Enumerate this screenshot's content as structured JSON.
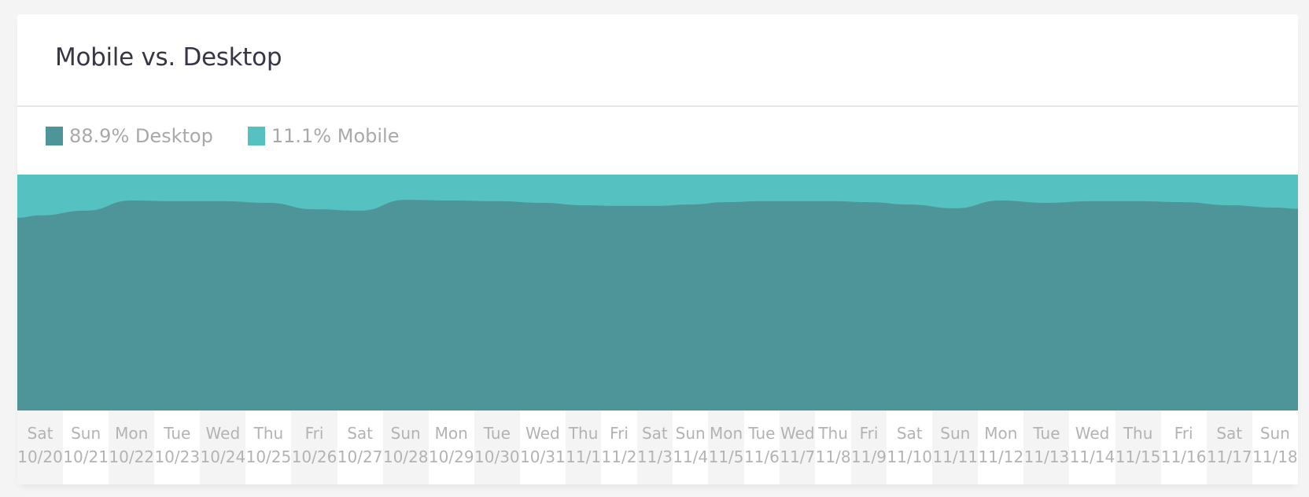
{
  "card": {
    "title": "Mobile vs. Desktop"
  },
  "legend": [
    {
      "label": "88.9% Desktop",
      "color": "#4d9598"
    },
    {
      "label": "11.1% Mobile",
      "color": "#55c1c0"
    }
  ],
  "chart_data": {
    "type": "area",
    "stacked": true,
    "normalized": true,
    "title": "Mobile vs. Desktop",
    "xlabel": "",
    "ylabel": "",
    "ylim": [
      0,
      100
    ],
    "grid": false,
    "legend_position": "top-left",
    "categories": [
      {
        "day": "Sat",
        "date": "10/20"
      },
      {
        "day": "Sun",
        "date": "10/21"
      },
      {
        "day": "Mon",
        "date": "10/22"
      },
      {
        "day": "Tue",
        "date": "10/23"
      },
      {
        "day": "Wed",
        "date": "10/24"
      },
      {
        "day": "Thu",
        "date": "10/25"
      },
      {
        "day": "Fri",
        "date": "10/26"
      },
      {
        "day": "Sat",
        "date": "10/27"
      },
      {
        "day": "Sun",
        "date": "10/28"
      },
      {
        "day": "Mon",
        "date": "10/29"
      },
      {
        "day": "Tue",
        "date": "10/30"
      },
      {
        "day": "Wed",
        "date": "10/31"
      },
      {
        "day": "Thu",
        "date": "11/1"
      },
      {
        "day": "Fri",
        "date": "11/2"
      },
      {
        "day": "Sat",
        "date": "11/3"
      },
      {
        "day": "Sun",
        "date": "11/4"
      },
      {
        "day": "Mon",
        "date": "11/5"
      },
      {
        "day": "Tue",
        "date": "11/6"
      },
      {
        "day": "Wed",
        "date": "11/7"
      },
      {
        "day": "Thu",
        "date": "11/8"
      },
      {
        "day": "Fri",
        "date": "11/9"
      },
      {
        "day": "Sat",
        "date": "11/10"
      },
      {
        "day": "Sun",
        "date": "11/11"
      },
      {
        "day": "Mon",
        "date": "11/12"
      },
      {
        "day": "Tue",
        "date": "11/13"
      },
      {
        "day": "Wed",
        "date": "11/14"
      },
      {
        "day": "Thu",
        "date": "11/15"
      },
      {
        "day": "Fri",
        "date": "11/16"
      },
      {
        "day": "Sat",
        "date": "11/17"
      },
      {
        "day": "Sun",
        "date": "11/18"
      }
    ],
    "series": [
      {
        "name": "Desktop",
        "color": "#4d9598",
        "values": [
          82.7,
          84.7,
          89.0,
          88.7,
          88.7,
          88.0,
          85.3,
          84.7,
          89.3,
          89.0,
          88.7,
          88.0,
          87.0,
          86.7,
          86.7,
          87.3,
          88.3,
          88.7,
          88.7,
          88.7,
          88.3,
          87.3,
          85.7,
          89.0,
          88.0,
          88.7,
          88.7,
          88.3,
          87.0,
          86.0
        ]
      },
      {
        "name": "Mobile",
        "color": "#55c1c0",
        "values": [
          17.3,
          15.3,
          11.0,
          11.3,
          11.3,
          12.0,
          14.7,
          15.3,
          10.7,
          11.0,
          11.3,
          12.0,
          13.0,
          13.3,
          13.3,
          12.7,
          11.7,
          11.3,
          11.3,
          11.3,
          11.7,
          12.7,
          14.3,
          11.0,
          12.0,
          11.3,
          11.3,
          11.7,
          13.0,
          14.0
        ]
      }
    ]
  }
}
